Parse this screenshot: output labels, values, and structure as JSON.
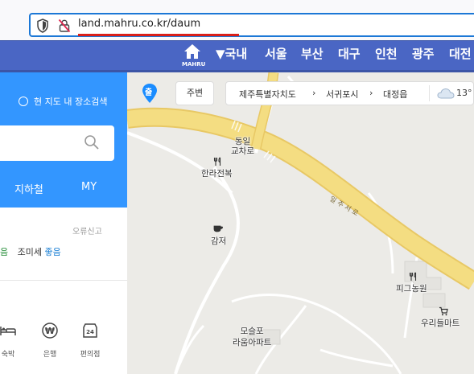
{
  "browser": {
    "url": "land.mahru.co.kr/daum"
  },
  "nav": {
    "home_label": "MAHRU",
    "items": [
      "▼국내",
      "서울",
      "부산",
      "대구",
      "인천",
      "광주",
      "대전"
    ]
  },
  "sidebar": {
    "radio_label": "현 지도 내 장소검색",
    "tabs": [
      "지하철",
      "MY"
    ],
    "report_label": "오류신고",
    "air_lead": "음",
    "air_text": "조미세",
    "air_value": "좋음",
    "categories": [
      "숙박",
      "은행",
      "편의점"
    ]
  },
  "map": {
    "departure_label": "출",
    "nearby_button": "주변",
    "breadcrumb": [
      "제주특별자치도",
      "서귀포시",
      "대정읍"
    ],
    "temperature": "13°",
    "places": {
      "intersection": [
        "동일",
        "교차로"
      ],
      "restaurant": "한라전복",
      "cafe": "감저",
      "farm": "피그농원",
      "mart": "우리들마트",
      "apartment": [
        "모슬포",
        "라움아파트"
      ]
    },
    "road_label": "일 주 서 로",
    "colors": {
      "road": "#f4dd82",
      "road_edge": "#e8c865",
      "minor_road": "#ffffff",
      "background": "#ecebe7",
      "nav": "#4a66c4",
      "panel": "#3396ff"
    }
  }
}
